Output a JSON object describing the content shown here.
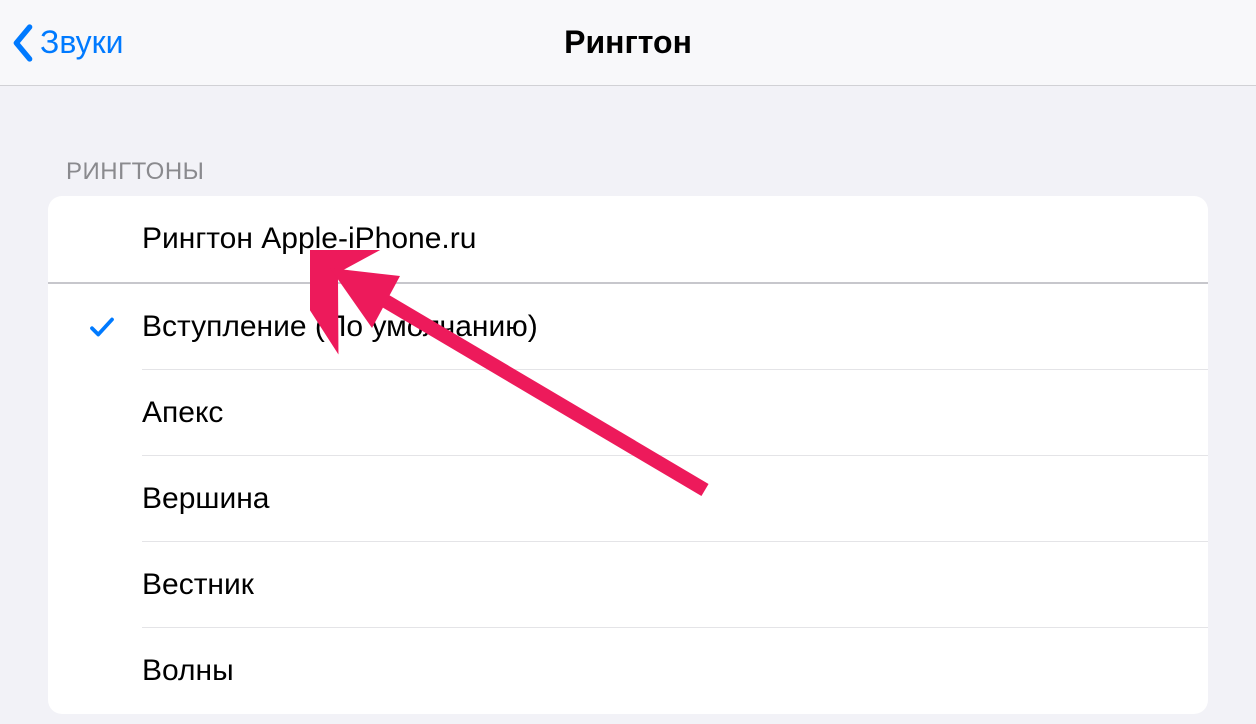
{
  "header": {
    "back_label": "Звуки",
    "title": "Рингтон"
  },
  "section_title": "РИНГТОНЫ",
  "custom_ringtones": [
    {
      "label": "Рингтон Apple-iPhone.ru",
      "selected": false
    }
  ],
  "system_ringtones": [
    {
      "label": "Вступление (По умолчанию)",
      "selected": true
    },
    {
      "label": "Апекс",
      "selected": false
    },
    {
      "label": "Вершина",
      "selected": false
    },
    {
      "label": "Вестник",
      "selected": false
    },
    {
      "label": "Волны",
      "selected": false
    }
  ],
  "colors": {
    "accent": "#007aff",
    "annotation": "#ed1a5b"
  }
}
